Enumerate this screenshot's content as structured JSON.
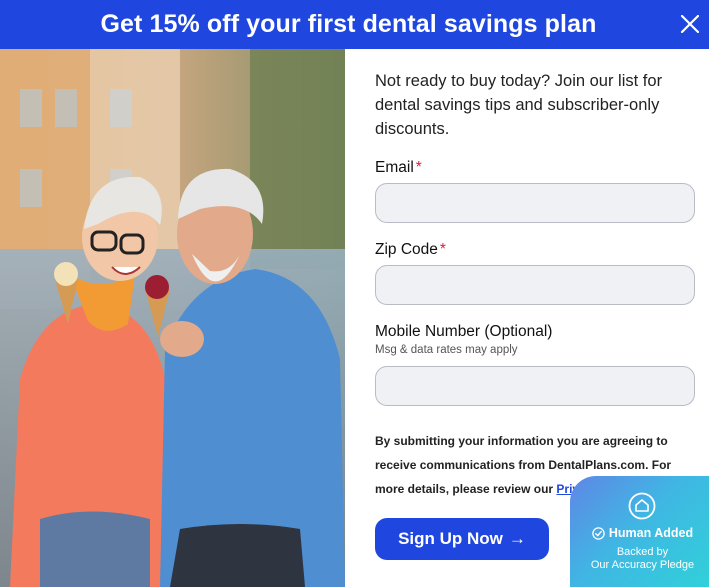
{
  "header": {
    "title": "Get 15% off your first dental savings plan"
  },
  "intro": "Not ready to buy today? Join our list for dental savings tips and subscriber-only discounts.",
  "form": {
    "email_label": "Email",
    "zip_label": "Zip Code",
    "mobile_label": "Mobile Number (Optional)",
    "mobile_hint": "Msg & data rates may apply",
    "required_mark": "*",
    "email_value": "",
    "zip_value": "",
    "mobile_value": ""
  },
  "consent": {
    "text": "By submitting your information you are agreeing to receive communications from DentalPlans.com. For more details, please review our",
    "link": "Privacy Policy"
  },
  "signup_button": {
    "label": "Sign Up Now",
    "arrow": "→"
  },
  "badge": {
    "title": "Human Added",
    "line1": "Backed by",
    "line2": "Our Accuracy Pledge"
  },
  "colors": {
    "brand_blue": "#1f47e0",
    "required_red": "#d5203a",
    "badge_teal": "#2fd2d8"
  },
  "icons": {
    "close": "close-icon",
    "badge_logo": "house-logo-icon",
    "check": "check-circle-icon"
  }
}
